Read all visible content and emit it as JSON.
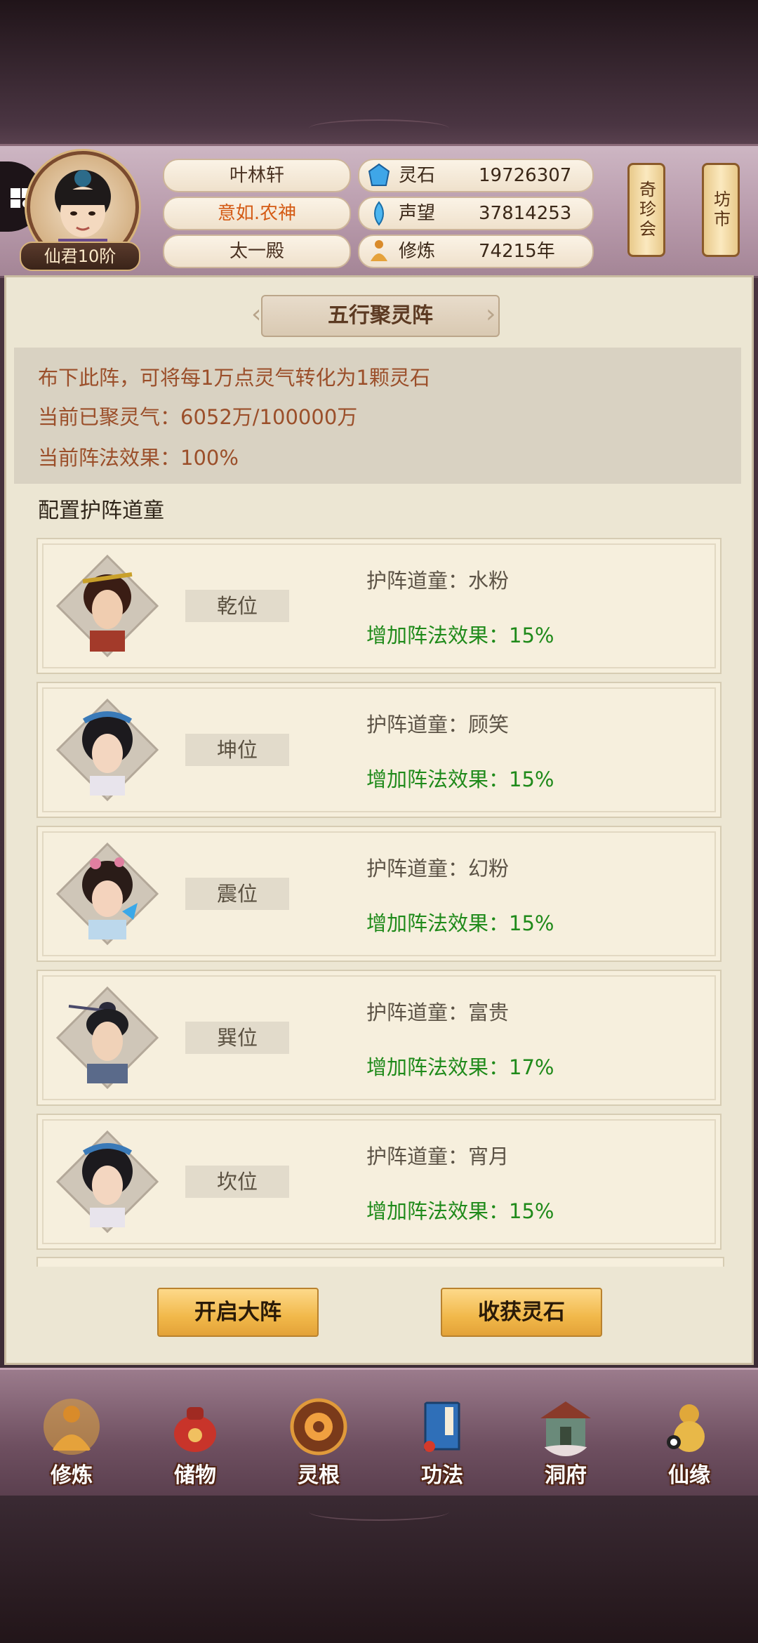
{
  "header": {
    "rank": "仙君10阶",
    "player_name": "叶林轩",
    "title": "意如.农神",
    "sect": "太一殿",
    "stats": [
      {
        "label": "灵石",
        "value": "19726307",
        "icon": "spirit-stone-icon"
      },
      {
        "label": "声望",
        "value": "37814253",
        "icon": "prestige-icon"
      },
      {
        "label": "修炼",
        "value": "74215年",
        "icon": "cultivation-icon"
      }
    ],
    "side_buttons": [
      "奇珍会",
      "坊市"
    ]
  },
  "panel": {
    "title": "五行聚灵阵",
    "info": [
      "布下此阵，可将每1万点灵气转化为1颗灵石",
      "当前已聚灵气：6052万/100000万",
      "当前阵法效果：100%"
    ],
    "section_label": "配置护阵道童",
    "guards": [
      {
        "position": "乾位",
        "guard": "护阵道童：水粉",
        "effect": "增加阵法效果：15%"
      },
      {
        "position": "坤位",
        "guard": "护阵道童：顾笑",
        "effect": "增加阵法效果：15%"
      },
      {
        "position": "震位",
        "guard": "护阵道童：幻粉",
        "effect": "增加阵法效果：15%"
      },
      {
        "position": "巽位",
        "guard": "护阵道童：富贵",
        "effect": "增加阵法效果：17%"
      },
      {
        "position": "坎位",
        "guard": "护阵道童：宵月",
        "effect": "增加阵法效果：15%"
      }
    ],
    "buttons": {
      "start": "开启大阵",
      "harvest": "收获灵石"
    }
  },
  "nav": [
    {
      "label": "修炼",
      "icon": "meditation-icon"
    },
    {
      "label": "储物",
      "icon": "storage-bag-icon"
    },
    {
      "label": "灵根",
      "icon": "spirit-root-icon"
    },
    {
      "label": "功法",
      "icon": "scripture-book-icon"
    },
    {
      "label": "洞府",
      "icon": "cave-mansion-icon"
    },
    {
      "label": "仙缘",
      "icon": "immortal-gourd-icon"
    }
  ],
  "colors": {
    "panel_bg": "#ece6d3",
    "info_text": "#9b4f2a",
    "effect_text": "#1f8a1a",
    "button_gold": "#f1b84a"
  }
}
